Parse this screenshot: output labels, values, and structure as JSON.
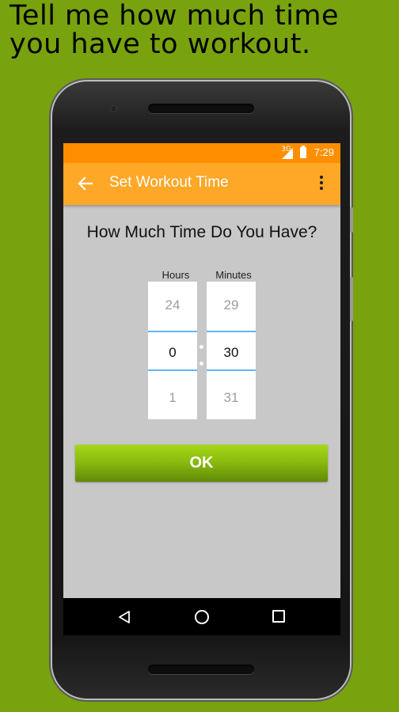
{
  "headline": "Tell me how much time you have to workout.",
  "status_bar": {
    "network": "3G",
    "time": "7:29",
    "signal_icon": "signal-icon",
    "battery_icon": "battery-charging-icon"
  },
  "app_bar": {
    "title": "Set Workout Time",
    "back_icon": "arrow-back-icon",
    "overflow_icon": "more-vert-icon"
  },
  "main": {
    "question": "How Much Time Do You Have?",
    "hours": {
      "label": "Hours",
      "prev": "24",
      "current": "0",
      "next": "1"
    },
    "minutes": {
      "label": "Minutes",
      "prev": "29",
      "current": "30",
      "next": "31"
    },
    "ok_label": "OK"
  },
  "nav_bar": {
    "back_icon": "triangle-back-icon",
    "home_icon": "circle-home-icon",
    "recents_icon": "square-recents-icon"
  },
  "colors": {
    "background": "#79a20f",
    "status_bar": "#ff8f00",
    "app_bar": "#ffa726",
    "screen_bg": "#c8c8c8",
    "ok_button": "#88b80e",
    "picker_divider": "#64b5f6"
  }
}
